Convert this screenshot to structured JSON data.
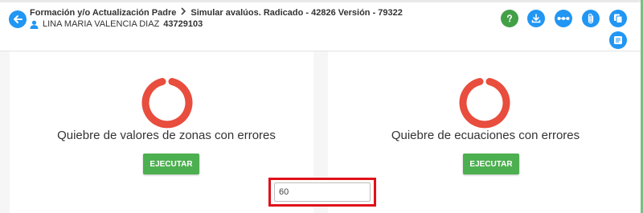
{
  "header": {
    "breadcrumb": {
      "parent": "Formación y/o Actualización Padre",
      "current": "Simular avalúos. Radicado - 42826 Versión - 79322"
    },
    "user": {
      "name": "LINA MARIA VALENCIA DIAZ",
      "id": "43729103"
    },
    "toolbar": [
      {
        "name": "help-icon",
        "color": "#43a047"
      },
      {
        "name": "download-icon",
        "color": "#2196f3"
      },
      {
        "name": "share-nodes-icon",
        "color": "#2196f3"
      },
      {
        "name": "attach-icon",
        "color": "#2196f3"
      },
      {
        "name": "copy-icon",
        "color": "#2196f3"
      },
      {
        "name": "notes-icon",
        "color": "#2196f3"
      }
    ]
  },
  "panels": [
    {
      "title": "Quiebre de valores de zonas con errores",
      "button": "EJECUTAR",
      "status_color": "#e84d3d"
    },
    {
      "title": "Quiebre de ecuaciones con errores",
      "button": "EJECUTAR",
      "status_color": "#e84d3d"
    }
  ],
  "input": {
    "value": "60"
  },
  "colors": {
    "primary": "#2196f3",
    "success": "#4caf50",
    "error": "#e84d3d",
    "highlight": "#e0101a"
  }
}
